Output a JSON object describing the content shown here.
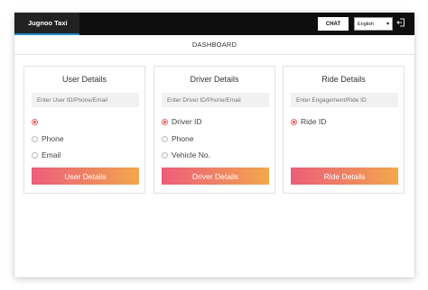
{
  "header": {
    "brand": "Jugnoo Taxi",
    "chat_label": "CHAT",
    "language": "English",
    "logout_icon": "logout-icon"
  },
  "page_title": "DASHBOARD",
  "cards": [
    {
      "title": "User Details",
      "input_placeholder": "Enter User ID/Phone/Email",
      "options": [
        "",
        "Phone",
        "Email"
      ],
      "selected_index": 0,
      "button_label": "User Details"
    },
    {
      "title": "Driver Details",
      "input_placeholder": "Enter Driver ID/Phone/Email",
      "options": [
        "Driver ID",
        "Phone",
        "Vehicle No."
      ],
      "selected_index": 0,
      "button_label": "Driver Details"
    },
    {
      "title": "Ride Details",
      "input_placeholder": "Enter Engagement/Ride ID",
      "options": [
        "Ride ID"
      ],
      "selected_index": 0,
      "button_label": "Ride Details"
    }
  ],
  "colors": {
    "topbar": "#0e0e0e",
    "brand_underline": "#1e88c7",
    "button_gradient_start": "#ec5e7a",
    "button_gradient_end": "#f3a84b",
    "radio_checked": "#e8505b"
  }
}
